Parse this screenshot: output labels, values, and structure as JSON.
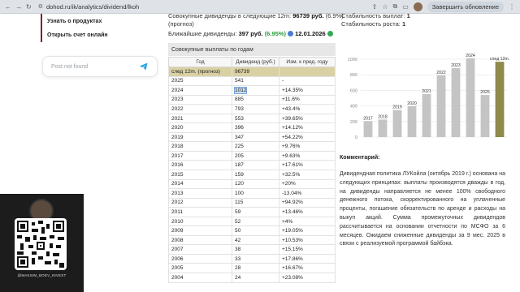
{
  "browser": {
    "url": "dohod.ru/ik/analytics/dividend/lkoh",
    "update_label": "Завершить обновление"
  },
  "sidebar": {
    "items": [
      {
        "label": "Узнать о продуктах"
      },
      {
        "label": "Открыть счет онлайн"
      }
    ],
    "telegram_placeholder": "Post not found"
  },
  "qr": {
    "handle": "@MAKSIM_BOEV_INVEST"
  },
  "header": {
    "prev_line": "Совокупные дивиденды в следующие 12m:",
    "prev_value": "96739 руб.",
    "prev_pct": "(6.9%)",
    "forecast_note": "(прогноз)",
    "nearest_label": "Ближайшие дивиденды:",
    "nearest_value": "397 руб.",
    "nearest_pct": "(6.95%)",
    "nearest_date": "12.01.2026"
  },
  "table": {
    "title": "Совокупные выплаты по годам",
    "columns": [
      "Год",
      "Дивиденд (руб.)",
      "Изм. к пред. году"
    ],
    "rows": [
      {
        "year": "след 12m. (прогноз)",
        "div": "96739",
        "chg": "",
        "kind": "forecast"
      },
      {
        "year": "2025",
        "div": "541",
        "chg": "-",
        "kind": "none"
      },
      {
        "year": "2024",
        "div": "1012",
        "chg": "+14.35%",
        "kind": "pos",
        "selected": true
      },
      {
        "year": "2023",
        "div": "885",
        "chg": "+11.6%",
        "kind": "pos"
      },
      {
        "year": "2022",
        "div": "793",
        "chg": "+43.4%",
        "kind": "pos"
      },
      {
        "year": "2021",
        "div": "553",
        "chg": "+39.65%",
        "kind": "pos"
      },
      {
        "year": "2020",
        "div": "396",
        "chg": "+14.12%",
        "kind": "pos"
      },
      {
        "year": "2019",
        "div": "347",
        "chg": "+54.22%",
        "kind": "pos"
      },
      {
        "year": "2018",
        "div": "225",
        "chg": "+9.76%",
        "kind": "pos"
      },
      {
        "year": "2017",
        "div": "205",
        "chg": "+9.63%",
        "kind": "pos"
      },
      {
        "year": "2016",
        "div": "187",
        "chg": "+17.61%",
        "kind": "pos"
      },
      {
        "year": "2015",
        "div": "159",
        "chg": "+32.5%",
        "kind": "pos"
      },
      {
        "year": "2014",
        "div": "120",
        "chg": "+20%",
        "kind": "pos"
      },
      {
        "year": "2013",
        "div": "100",
        "chg": "-13.04%",
        "kind": "neg"
      },
      {
        "year": "2012",
        "div": "115",
        "chg": "+94.92%",
        "kind": "pos"
      },
      {
        "year": "2011",
        "div": "59",
        "chg": "+13.46%",
        "kind": "pos"
      },
      {
        "year": "2010",
        "div": "52",
        "chg": "+4%",
        "kind": "pos"
      },
      {
        "year": "2009",
        "div": "50",
        "chg": "+19.05%",
        "kind": "pos"
      },
      {
        "year": "2008",
        "div": "42",
        "chg": "+10.53%",
        "kind": "pos"
      },
      {
        "year": "2007",
        "div": "38",
        "chg": "+15.15%",
        "kind": "pos"
      },
      {
        "year": "2006",
        "div": "33",
        "chg": "+17.86%",
        "kind": "pos"
      },
      {
        "year": "2005",
        "div": "28",
        "chg": "+16.67%",
        "kind": "pos"
      },
      {
        "year": "2004",
        "div": "24",
        "chg": "+23.08%",
        "kind": "pos"
      }
    ]
  },
  "stability": {
    "payouts_label": "Стабильность выплат:",
    "payouts_value": "1",
    "growth_label": "Стабильность роста:",
    "growth_value": "1"
  },
  "chart_data": {
    "type": "bar",
    "categories": [
      "2017",
      "2018",
      "2019",
      "2020",
      "2021",
      "2022",
      "2023",
      "2024",
      "2025",
      "след 12m."
    ],
    "values": [
      205,
      225,
      347,
      396,
      553,
      793,
      885,
      1012,
      541,
      967
    ],
    "ylim": [
      0,
      1000
    ],
    "yticks": [
      0,
      200,
      400,
      600,
      800,
      1000
    ],
    "grid": true,
    "colors": {
      "bar": "#c4c4c4",
      "forecast_bar": "#8d8a4c"
    }
  },
  "comment": {
    "title": "Комментарий:",
    "text": "Дивидендная политика ЛУКойла (октябрь 2019 г.) основана на следующих принципах: выплаты производятся дважды в год, на дивиденды направляется не менее 100% свободного денежного потока, скорректированного на уплаченные проценты, погашение обязательств по аренде и расходы на выкуп акций. Сумма промежуточных дивидендов рассчитывается на основании отчетности по МСФО за 6 месяцев. Ожидаем сниженные дивиденды за 9 мес. 2025 в связи с реализуемой программой байбэка."
  }
}
